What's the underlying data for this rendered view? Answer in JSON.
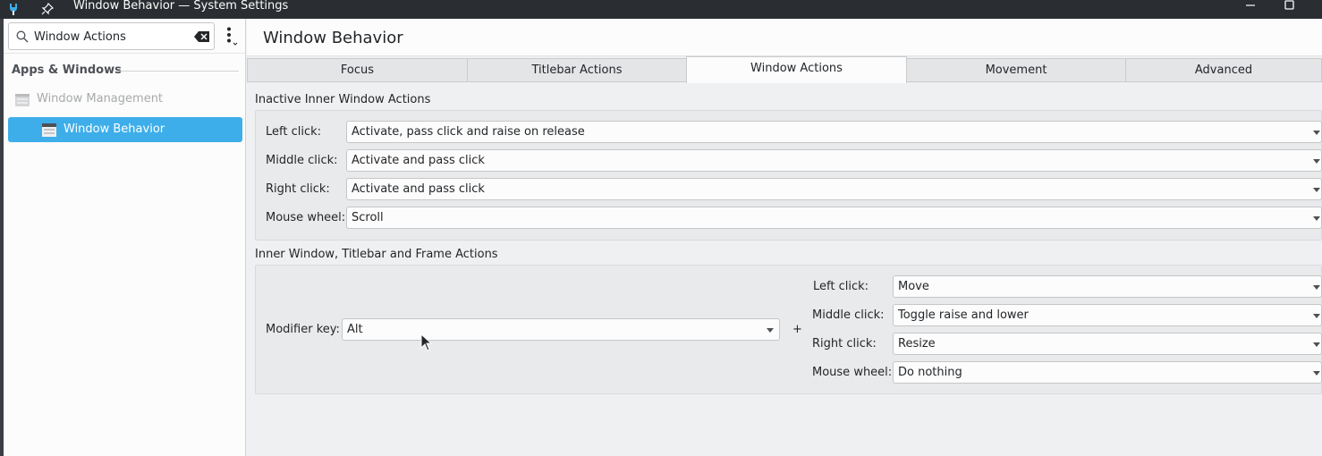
{
  "window": {
    "title": "Window Behavior — System Settings"
  },
  "sidebar": {
    "search_value": "Window Actions",
    "section": "Apps & Windows",
    "items": [
      {
        "label": "Window Management"
      },
      {
        "label": "Window Behavior"
      }
    ]
  },
  "main": {
    "page_title": "Window Behavior",
    "tabs": [
      {
        "label": "Focus"
      },
      {
        "label": "Titlebar Actions"
      },
      {
        "label": "Window Actions"
      },
      {
        "label": "Movement"
      },
      {
        "label": "Advanced"
      }
    ],
    "inactive_group": {
      "title": "Inactive Inner Window Actions",
      "rows": [
        {
          "label": "Left click:",
          "value": "Activate, pass click and raise on release"
        },
        {
          "label": "Middle click:",
          "value": "Activate and pass click"
        },
        {
          "label": "Right click:",
          "value": "Activate and pass click"
        },
        {
          "label": "Mouse wheel:",
          "value": "Scroll"
        }
      ]
    },
    "frame_group": {
      "title": "Inner Window, Titlebar and Frame Actions",
      "modifier_label": "Modifier key:",
      "modifier_value": "Alt",
      "plus": "+",
      "rows": [
        {
          "label": "Left click:",
          "value": "Move"
        },
        {
          "label": "Middle click:",
          "value": "Toggle raise and lower"
        },
        {
          "label": "Right click:",
          "value": "Resize"
        },
        {
          "label": "Mouse wheel:",
          "value": "Do nothing"
        }
      ]
    }
  },
  "colors": {
    "accent": "#3daee9",
    "titlebar": "#2a2e32"
  }
}
